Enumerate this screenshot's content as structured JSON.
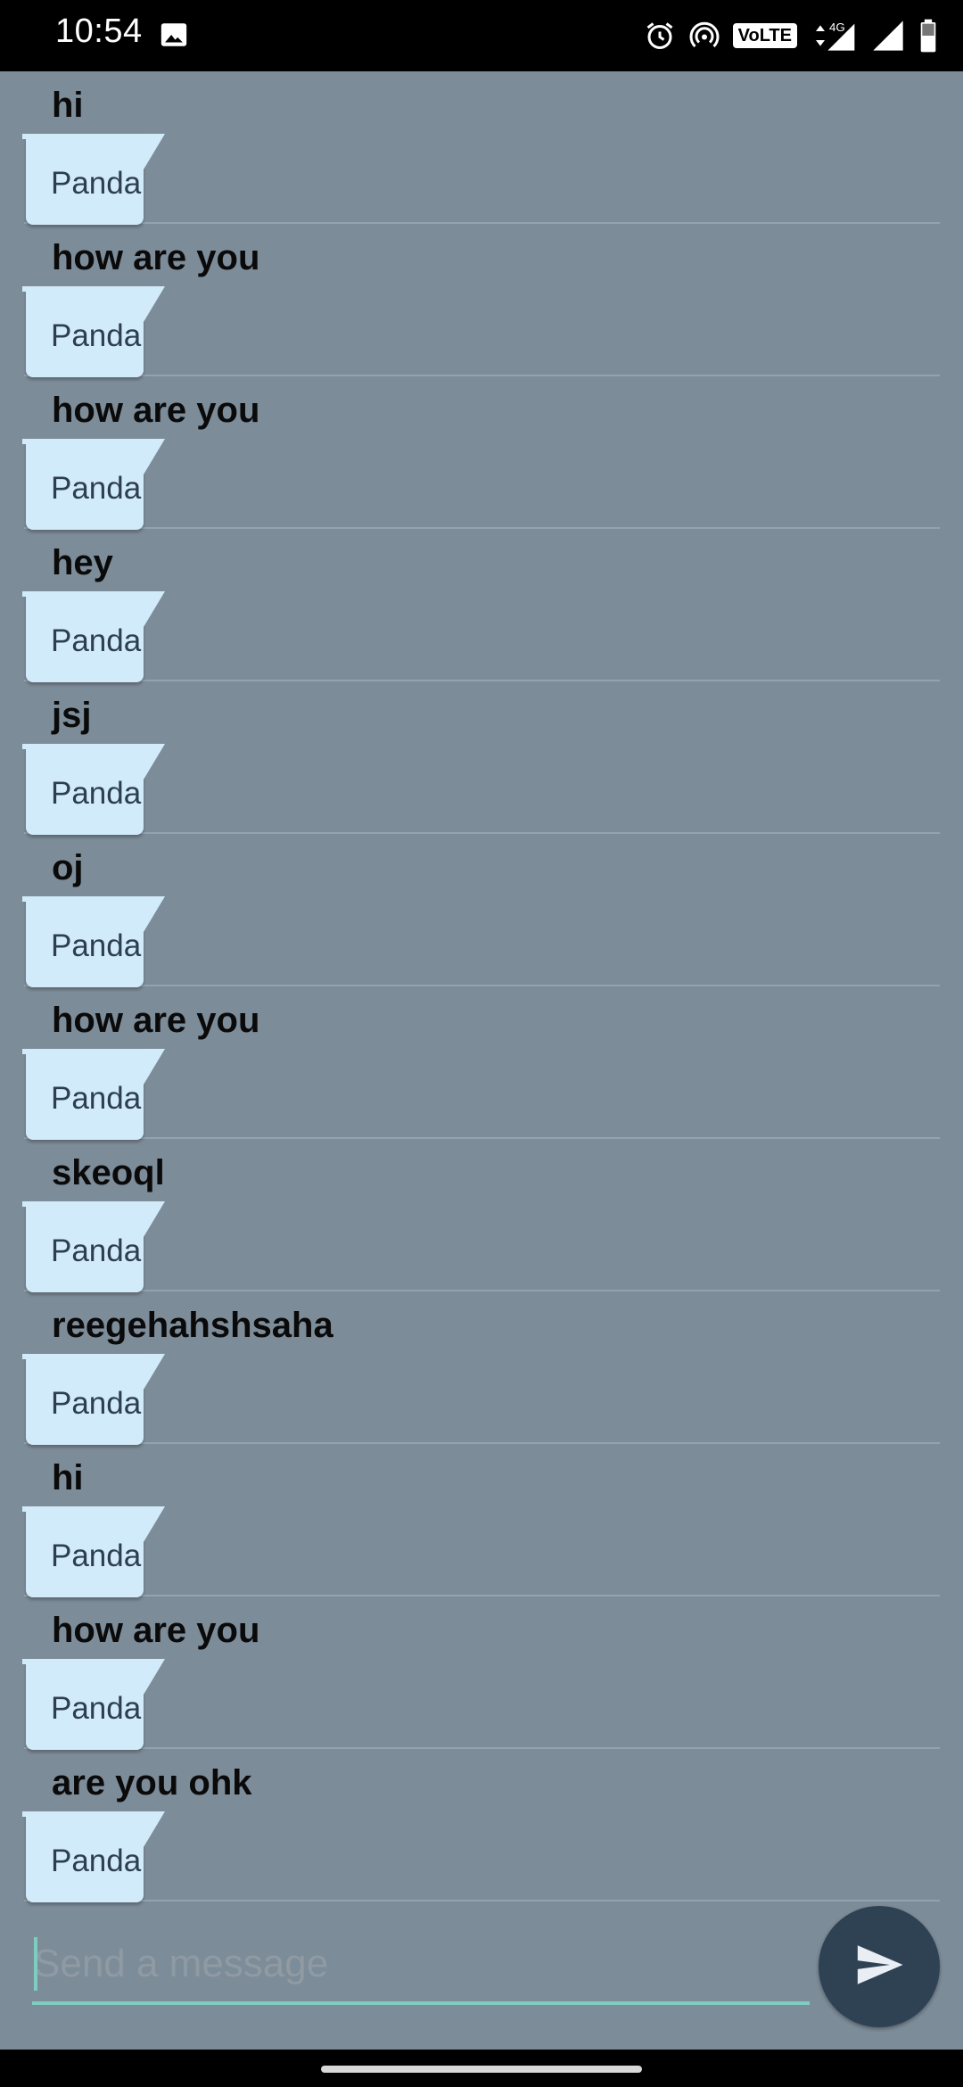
{
  "status_bar": {
    "time": "10:54",
    "volte": "VoLTE",
    "network": "4G",
    "icons": [
      "image-icon",
      "alarm-icon",
      "hotspot-icon",
      "volte-icon",
      "data-arrows-icon",
      "signal-icon",
      "signal-icon",
      "battery-icon"
    ]
  },
  "messages": [
    {
      "text": "hi",
      "sender": "Panda"
    },
    {
      "text": "how are you",
      "sender": "Panda"
    },
    {
      "text": "how are you",
      "sender": "Panda"
    },
    {
      "text": "hey",
      "sender": "Panda"
    },
    {
      "text": "jsj",
      "sender": "Panda"
    },
    {
      "text": "oj",
      "sender": "Panda"
    },
    {
      "text": "how are you",
      "sender": "Panda"
    },
    {
      "text": "skeoql",
      "sender": "Panda"
    },
    {
      "text": "reegehahshsaha",
      "sender": "Panda"
    },
    {
      "text": "hi",
      "sender": "Panda"
    },
    {
      "text": "how are you",
      "sender": "Panda"
    },
    {
      "text": "are you ohk",
      "sender": "Panda"
    }
  ],
  "composer": {
    "placeholder": "Send a message",
    "value": "",
    "send_icon": "send-icon"
  },
  "colors": {
    "background": "#7d8c99",
    "bubble": "#d2ebfb",
    "accent": "#7fcdc1",
    "send_button": "#2f4254"
  }
}
